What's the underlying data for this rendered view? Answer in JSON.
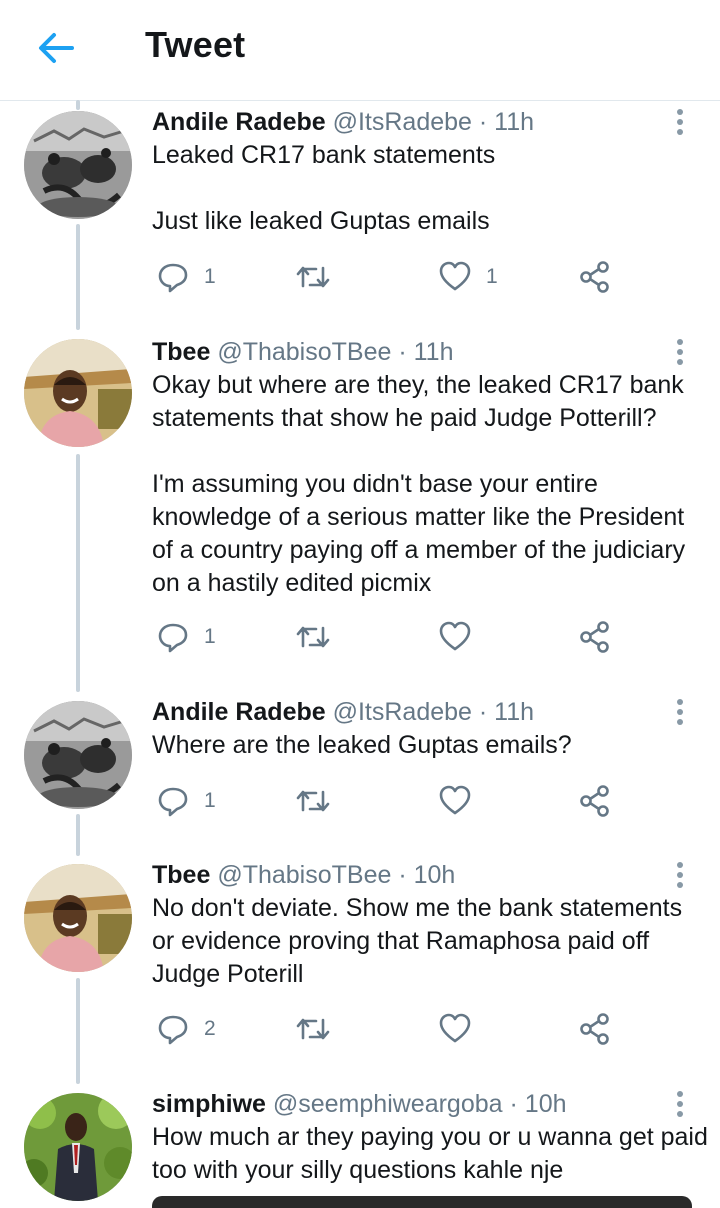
{
  "header": {
    "title": "Tweet",
    "back_icon": "arrow-left-icon",
    "accent": "#1da1f2"
  },
  "colors": {
    "name": "#14171a",
    "meta": "#657786",
    "icon": "#657786",
    "thread_line": "#c8d3dc"
  },
  "tweets": [
    {
      "name": "Andile Radebe",
      "handle": "@ItsRadebe",
      "time": "· 11h",
      "text": "Leaked CR17 bank statements\n\nJust like leaked Guptas emails",
      "reply_count": "1",
      "retweet_count": "",
      "like_count": "1",
      "avatar": "andile-radebe-avatar"
    },
    {
      "name": "Tbee",
      "handle": "@ThabisoTBee",
      "time": "· 11h",
      "text": "Okay but where are they, the leaked CR17 bank statements that show he paid Judge Potterill?\n\nI'm assuming you didn't base your entire knowledge of a serious matter like the President of a country paying off a member of the judiciary on a hastily edited picmix",
      "reply_count": "1",
      "retweet_count": "",
      "like_count": "",
      "avatar": "tbee-avatar"
    },
    {
      "name": "Andile Radebe",
      "handle": "@ItsRadebe",
      "time": "· 11h",
      "text": "Where are the leaked Guptas emails?",
      "reply_count": "1",
      "retweet_count": "",
      "like_count": "",
      "avatar": "andile-radebe-avatar"
    },
    {
      "name": "Tbee",
      "handle": "@ThabisoTBee",
      "time": "· 10h",
      "text": "No don't deviate. Show me the bank statements or evidence proving that Ramaphosa paid off Judge Poterill",
      "reply_count": "2",
      "retweet_count": "",
      "like_count": "",
      "avatar": "tbee-avatar"
    },
    {
      "name": "simphiwe",
      "handle": "@seemphiweargoba",
      "time": "· 10h",
      "text": "How much ar they paying you or u wanna get paid too with your silly questions kahle nje",
      "avatar": "simphiwe-avatar"
    }
  ]
}
